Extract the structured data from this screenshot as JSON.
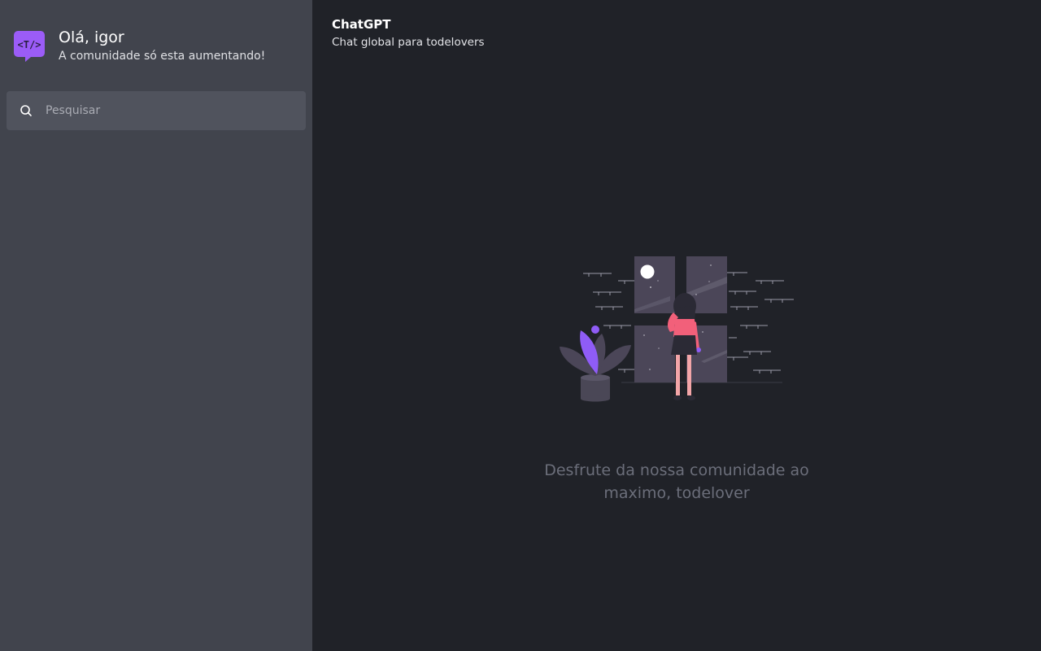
{
  "sidebar": {
    "greeting_title": "Olá, igor",
    "greeting_subtitle": "A comunidade só esta aumentando!",
    "search": {
      "placeholder": "Pesquisar",
      "value": ""
    }
  },
  "chat": {
    "title": "ChatGPT",
    "subtitle": "Chat global para todelovers"
  },
  "empty_state": {
    "message": "Desfrute da nossa comunidade ao maximo, todelover"
  },
  "icons": {
    "logo": "todelovers-chat-logo-icon",
    "search": "search-icon",
    "illustration": "woman-at-window-illustration"
  },
  "colors": {
    "sidebar_bg": "#41444d",
    "main_bg": "#202228",
    "search_bg": "#50535d",
    "accent_purple": "#8f5cf6",
    "muted_text": "#6b6e7a"
  }
}
